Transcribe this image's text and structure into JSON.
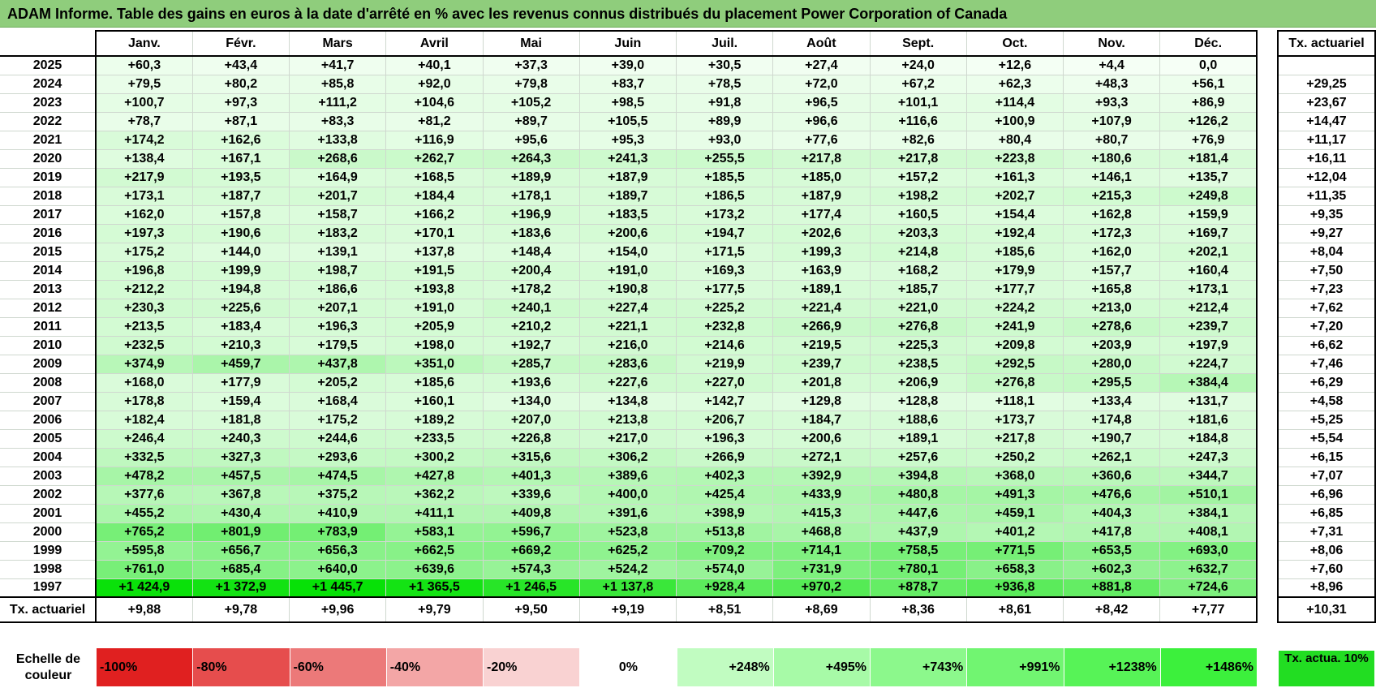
{
  "title": "ADAM Informe. Table des gains en euros à la date d'arrêté en % avec les revenus connus distribués du placement Power Corporation of Canada",
  "months": [
    "Janv.",
    "Févr.",
    "Mars",
    "Avril",
    "Mai",
    "Juin",
    "Juil.",
    "Août",
    "Sept.",
    "Oct.",
    "Nov.",
    "Déc."
  ],
  "side_header": "Tx. actuariel",
  "footer_label": "Tx. actuariel",
  "scale_label": "Echelle de couleur",
  "scale_side_label": "Tx. actua. 10%",
  "colors": {
    "title_bg": "#8fcd7c",
    "max_green": "#00e000",
    "max_red": "#e02020",
    "side_scale": "#22dd22"
  },
  "chart_data": {
    "type": "table",
    "title": "ADAM Informe. Table des gains en euros à la date d'arrêté en % avec les revenus connus distribués du placement Power Corporation of Canada",
    "columns": [
      "Janv.",
      "Févr.",
      "Mars",
      "Avril",
      "Mai",
      "Juin",
      "Juil.",
      "Août",
      "Sept.",
      "Oct.",
      "Nov.",
      "Déc.",
      "Tx. actuariel"
    ],
    "rows": [
      {
        "year": "2025",
        "values": [
          "+60,3",
          "+43,4",
          "+41,7",
          "+40,1",
          "+37,3",
          "+39,0",
          "+30,5",
          "+27,4",
          "+24,0",
          "+12,6",
          "+4,4",
          "0,0"
        ],
        "rate": ""
      },
      {
        "year": "2024",
        "values": [
          "+79,5",
          "+80,2",
          "+85,8",
          "+92,0",
          "+79,8",
          "+83,7",
          "+78,5",
          "+72,0",
          "+67,2",
          "+62,3",
          "+48,3",
          "+56,1"
        ],
        "rate": "+29,25"
      },
      {
        "year": "2023",
        "values": [
          "+100,7",
          "+97,3",
          "+111,2",
          "+104,6",
          "+105,2",
          "+98,5",
          "+91,8",
          "+96,5",
          "+101,1",
          "+114,4",
          "+93,3",
          "+86,9"
        ],
        "rate": "+23,67"
      },
      {
        "year": "2022",
        "values": [
          "+78,7",
          "+87,1",
          "+83,3",
          "+81,2",
          "+89,7",
          "+105,5",
          "+89,9",
          "+96,6",
          "+116,6",
          "+100,9",
          "+107,9",
          "+126,2"
        ],
        "rate": "+14,47"
      },
      {
        "year": "2021",
        "values": [
          "+174,2",
          "+162,6",
          "+133,8",
          "+116,9",
          "+95,6",
          "+95,3",
          "+93,0",
          "+77,6",
          "+82,6",
          "+80,4",
          "+80,7",
          "+76,9"
        ],
        "rate": "+11,17"
      },
      {
        "year": "2020",
        "values": [
          "+138,4",
          "+167,1",
          "+268,6",
          "+262,7",
          "+264,3",
          "+241,3",
          "+255,5",
          "+217,8",
          "+217,8",
          "+223,8",
          "+180,6",
          "+181,4"
        ],
        "rate": "+16,11"
      },
      {
        "year": "2019",
        "values": [
          "+217,9",
          "+193,5",
          "+164,9",
          "+168,5",
          "+189,9",
          "+187,9",
          "+185,5",
          "+185,0",
          "+157,2",
          "+161,3",
          "+146,1",
          "+135,7"
        ],
        "rate": "+12,04"
      },
      {
        "year": "2018",
        "values": [
          "+173,1",
          "+187,7",
          "+201,7",
          "+184,4",
          "+178,1",
          "+189,7",
          "+186,5",
          "+187,9",
          "+198,2",
          "+202,7",
          "+215,3",
          "+249,8"
        ],
        "rate": "+11,35"
      },
      {
        "year": "2017",
        "values": [
          "+162,0",
          "+157,8",
          "+158,7",
          "+166,2",
          "+196,9",
          "+183,5",
          "+173,2",
          "+177,4",
          "+160,5",
          "+154,4",
          "+162,8",
          "+159,9"
        ],
        "rate": "+9,35"
      },
      {
        "year": "2016",
        "values": [
          "+197,3",
          "+190,6",
          "+183,2",
          "+170,1",
          "+183,6",
          "+200,6",
          "+194,7",
          "+202,6",
          "+203,3",
          "+192,4",
          "+172,3",
          "+169,7"
        ],
        "rate": "+9,27"
      },
      {
        "year": "2015",
        "values": [
          "+175,2",
          "+144,0",
          "+139,1",
          "+137,8",
          "+148,4",
          "+154,0",
          "+171,5",
          "+199,3",
          "+214,8",
          "+185,6",
          "+162,0",
          "+202,1"
        ],
        "rate": "+8,04"
      },
      {
        "year": "2014",
        "values": [
          "+196,8",
          "+199,9",
          "+198,7",
          "+191,5",
          "+200,4",
          "+191,0",
          "+169,3",
          "+163,9",
          "+168,2",
          "+179,9",
          "+157,7",
          "+160,4"
        ],
        "rate": "+7,50"
      },
      {
        "year": "2013",
        "values": [
          "+212,2",
          "+194,8",
          "+186,6",
          "+193,8",
          "+178,2",
          "+190,8",
          "+177,5",
          "+189,1",
          "+185,7",
          "+177,7",
          "+165,8",
          "+173,1"
        ],
        "rate": "+7,23"
      },
      {
        "year": "2012",
        "values": [
          "+230,3",
          "+225,6",
          "+207,1",
          "+191,0",
          "+240,1",
          "+227,4",
          "+225,2",
          "+221,4",
          "+221,0",
          "+224,2",
          "+213,0",
          "+212,4"
        ],
        "rate": "+7,62"
      },
      {
        "year": "2011",
        "values": [
          "+213,5",
          "+183,4",
          "+196,3",
          "+205,9",
          "+210,2",
          "+221,1",
          "+232,8",
          "+266,9",
          "+276,8",
          "+241,9",
          "+278,6",
          "+239,7"
        ],
        "rate": "+7,20"
      },
      {
        "year": "2010",
        "values": [
          "+232,5",
          "+210,3",
          "+179,5",
          "+198,0",
          "+192,7",
          "+216,0",
          "+214,6",
          "+219,5",
          "+225,3",
          "+209,8",
          "+203,9",
          "+197,9"
        ],
        "rate": "+6,62"
      },
      {
        "year": "2009",
        "values": [
          "+374,9",
          "+459,7",
          "+437,8",
          "+351,0",
          "+285,7",
          "+283,6",
          "+219,9",
          "+239,7",
          "+238,5",
          "+292,5",
          "+280,0",
          "+224,7"
        ],
        "rate": "+7,46"
      },
      {
        "year": "2008",
        "values": [
          "+168,0",
          "+177,9",
          "+205,2",
          "+185,6",
          "+193,6",
          "+227,6",
          "+227,0",
          "+201,8",
          "+206,9",
          "+276,8",
          "+295,5",
          "+384,4"
        ],
        "rate": "+6,29"
      },
      {
        "year": "2007",
        "values": [
          "+178,8",
          "+159,4",
          "+168,4",
          "+160,1",
          "+134,0",
          "+134,8",
          "+142,7",
          "+129,8",
          "+128,8",
          "+118,1",
          "+133,4",
          "+131,7"
        ],
        "rate": "+4,58"
      },
      {
        "year": "2006",
        "values": [
          "+182,4",
          "+181,8",
          "+175,2",
          "+189,2",
          "+207,0",
          "+213,8",
          "+206,7",
          "+184,7",
          "+188,6",
          "+173,7",
          "+174,8",
          "+181,6"
        ],
        "rate": "+5,25"
      },
      {
        "year": "2005",
        "values": [
          "+246,4",
          "+240,3",
          "+244,6",
          "+233,5",
          "+226,8",
          "+217,0",
          "+196,3",
          "+200,6",
          "+189,1",
          "+217,8",
          "+190,7",
          "+184,8"
        ],
        "rate": "+5,54"
      },
      {
        "year": "2004",
        "values": [
          "+332,5",
          "+327,3",
          "+293,6",
          "+300,2",
          "+315,6",
          "+306,2",
          "+266,9",
          "+272,1",
          "+257,6",
          "+250,2",
          "+262,1",
          "+247,3"
        ],
        "rate": "+6,15"
      },
      {
        "year": "2003",
        "values": [
          "+478,2",
          "+457,5",
          "+474,5",
          "+427,8",
          "+401,3",
          "+389,6",
          "+402,3",
          "+392,9",
          "+394,8",
          "+368,0",
          "+360,6",
          "+344,7"
        ],
        "rate": "+7,07"
      },
      {
        "year": "2002",
        "values": [
          "+377,6",
          "+367,8",
          "+375,2",
          "+362,2",
          "+339,6",
          "+400,0",
          "+425,4",
          "+433,9",
          "+480,8",
          "+491,3",
          "+476,6",
          "+510,1"
        ],
        "rate": "+6,96"
      },
      {
        "year": "2001",
        "values": [
          "+455,2",
          "+430,4",
          "+410,9",
          "+411,1",
          "+409,8",
          "+391,6",
          "+398,9",
          "+415,3",
          "+447,6",
          "+459,1",
          "+404,3",
          "+384,1"
        ],
        "rate": "+6,85"
      },
      {
        "year": "2000",
        "values": [
          "+765,2",
          "+801,9",
          "+783,9",
          "+583,1",
          "+596,7",
          "+523,8",
          "+513,8",
          "+468,8",
          "+437,9",
          "+401,2",
          "+417,8",
          "+408,1"
        ],
        "rate": "+7,31"
      },
      {
        "year": "1999",
        "values": [
          "+595,8",
          "+656,7",
          "+656,3",
          "+662,5",
          "+669,2",
          "+625,2",
          "+709,2",
          "+714,1",
          "+758,5",
          "+771,5",
          "+653,5",
          "+693,0"
        ],
        "rate": "+8,06"
      },
      {
        "year": "1998",
        "values": [
          "+761,0",
          "+685,4",
          "+640,0",
          "+639,6",
          "+574,3",
          "+524,2",
          "+574,0",
          "+731,9",
          "+780,1",
          "+658,3",
          "+602,3",
          "+632,7"
        ],
        "rate": "+7,60"
      },
      {
        "year": "1997",
        "values": [
          "+1 424,9",
          "+1 372,9",
          "+1 445,7",
          "+1 365,5",
          "+1 246,5",
          "+1 137,8",
          "+928,4",
          "+970,2",
          "+878,7",
          "+936,8",
          "+881,8",
          "+724,6"
        ],
        "rate": "+8,96"
      }
    ],
    "footer": [
      "+9,88",
      "+9,78",
      "+9,96",
      "+9,79",
      "+9,50",
      "+9,19",
      "+8,51",
      "+8,69",
      "+8,36",
      "+8,61",
      "+8,42",
      "+7,77"
    ],
    "footer_rate": "+10,31",
    "color_scale": [
      "-100%",
      "-80%",
      "-60%",
      "-40%",
      "-20%",
      "0%",
      "+248%",
      "+495%",
      "+743%",
      "+991%",
      "+1238%",
      "+1486%"
    ],
    "color_scale_values": [
      -100,
      -80,
      -60,
      -40,
      -20,
      0,
      248,
      495,
      743,
      991,
      1238,
      1486
    ]
  }
}
